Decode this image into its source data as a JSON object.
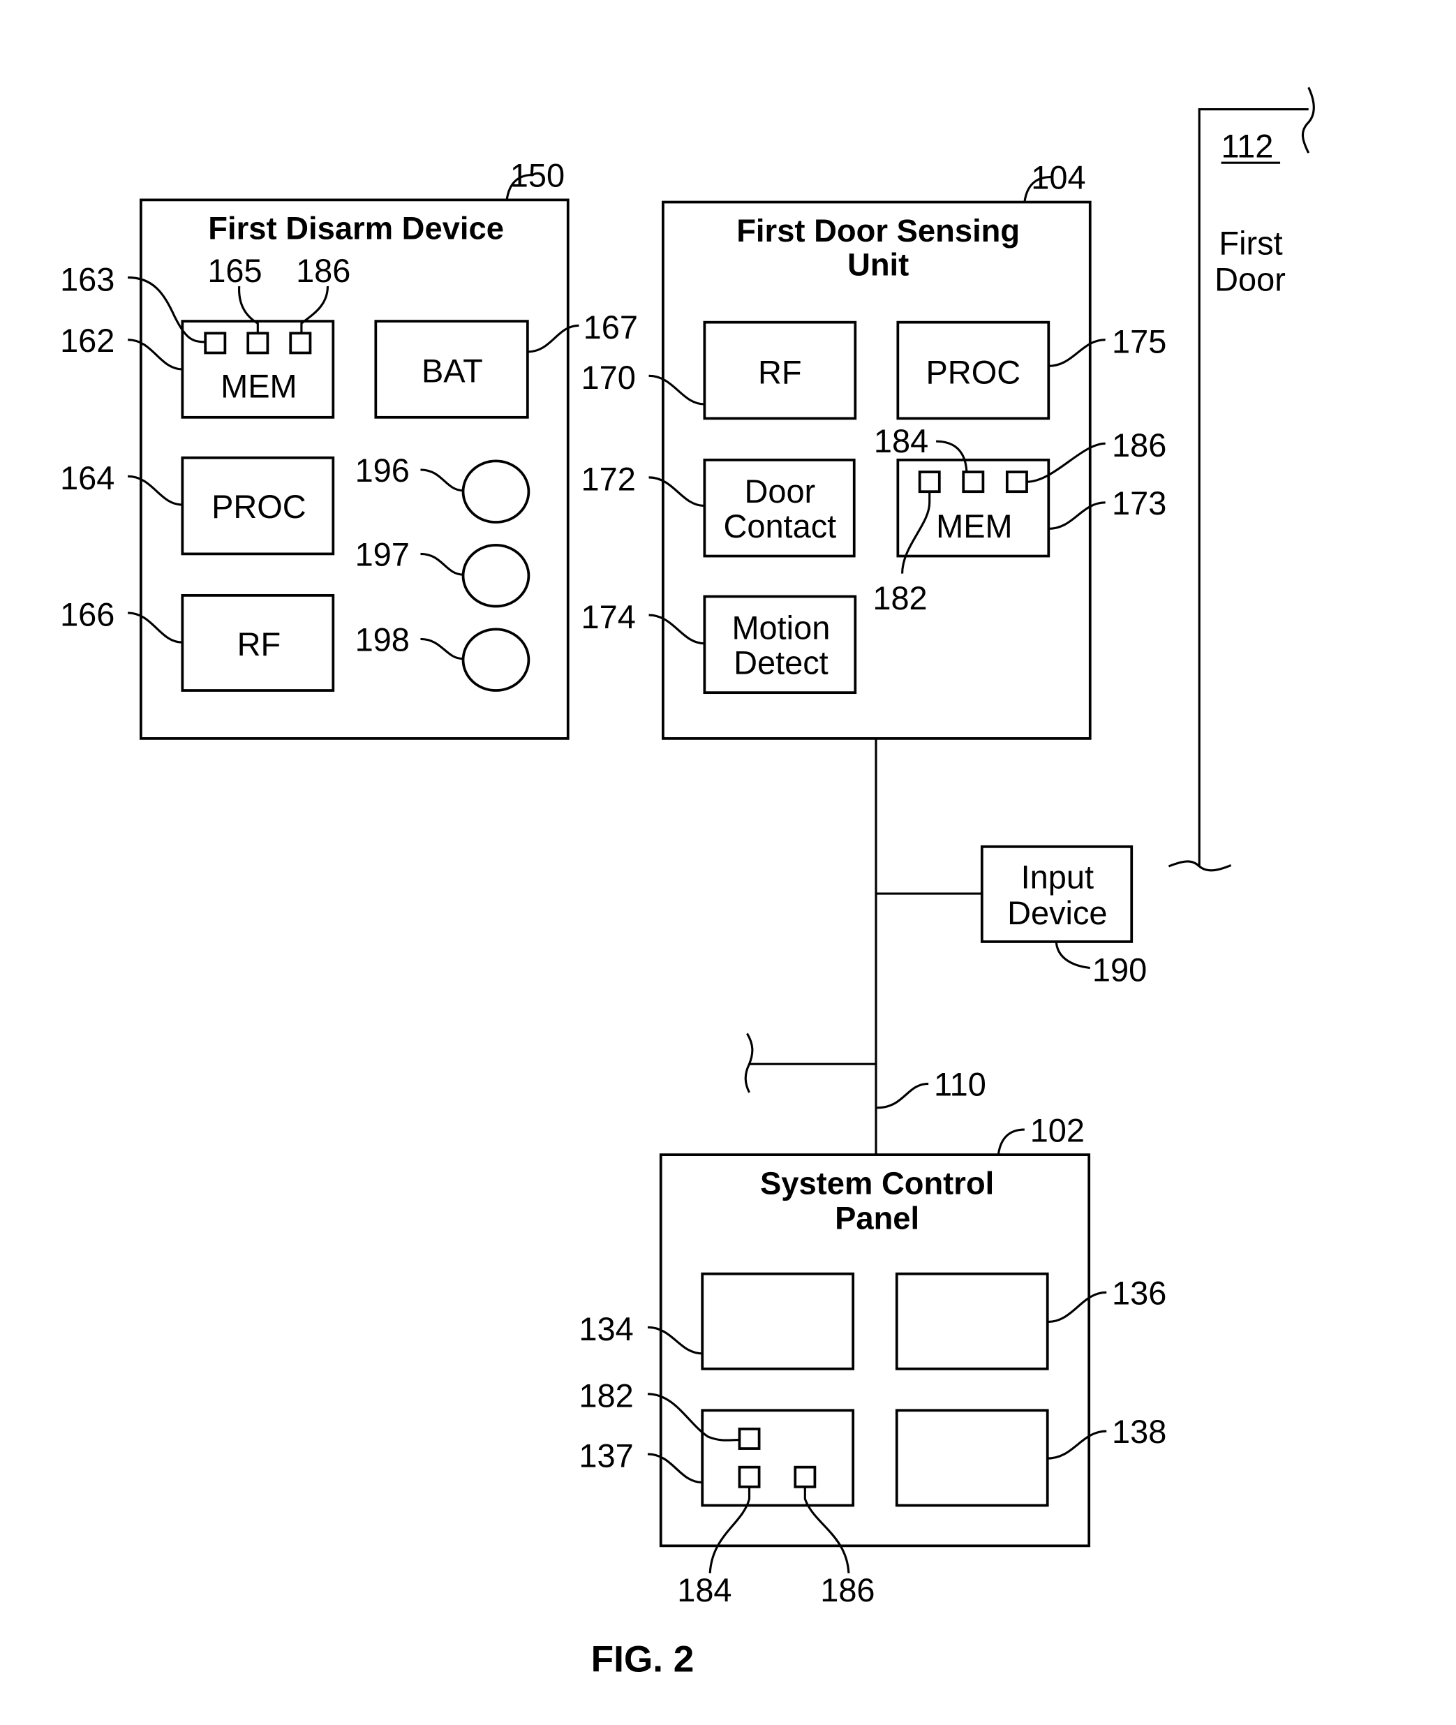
{
  "figure_label": "FIG. 2",
  "disarm_device": {
    "ref": "150",
    "title": "First Disarm Device",
    "mem": {
      "label": "MEM",
      "ref": "162",
      "cells": [
        "163",
        "165",
        "186"
      ]
    },
    "bat": {
      "label": "BAT",
      "ref": "167"
    },
    "proc": {
      "label": "PROC",
      "ref": "164"
    },
    "rf": {
      "label": "RF",
      "ref": "166"
    },
    "indicators": [
      "196",
      "197",
      "198"
    ]
  },
  "door_sensing_unit": {
    "ref": "104",
    "title_line1": "First Door Sensing",
    "title_line2": "Unit",
    "rf": {
      "label": "RF",
      "ref": "170"
    },
    "proc": {
      "label": "PROC",
      "ref": "175"
    },
    "door_contact": {
      "line1": "Door",
      "line2": "Contact",
      "ref": "172"
    },
    "mem": {
      "label": "MEM",
      "ref": "173",
      "cells": [
        "182",
        "184",
        "186"
      ]
    },
    "motion": {
      "line1": "Motion",
      "line2": "Detect",
      "ref": "174"
    }
  },
  "door": {
    "ref": "112",
    "line1": "First",
    "line2": "Door"
  },
  "input_device": {
    "line1": "Input",
    "line2": "Device",
    "ref": "190"
  },
  "bus": {
    "ref": "110"
  },
  "control_panel": {
    "ref": "102",
    "title_line1": "System Control",
    "title_line2": "Panel",
    "blocks": {
      "top_left": "134",
      "top_right": "136",
      "bottom_left": "137",
      "bottom_right": "138"
    },
    "cells": [
      "182",
      "184",
      "186"
    ]
  }
}
